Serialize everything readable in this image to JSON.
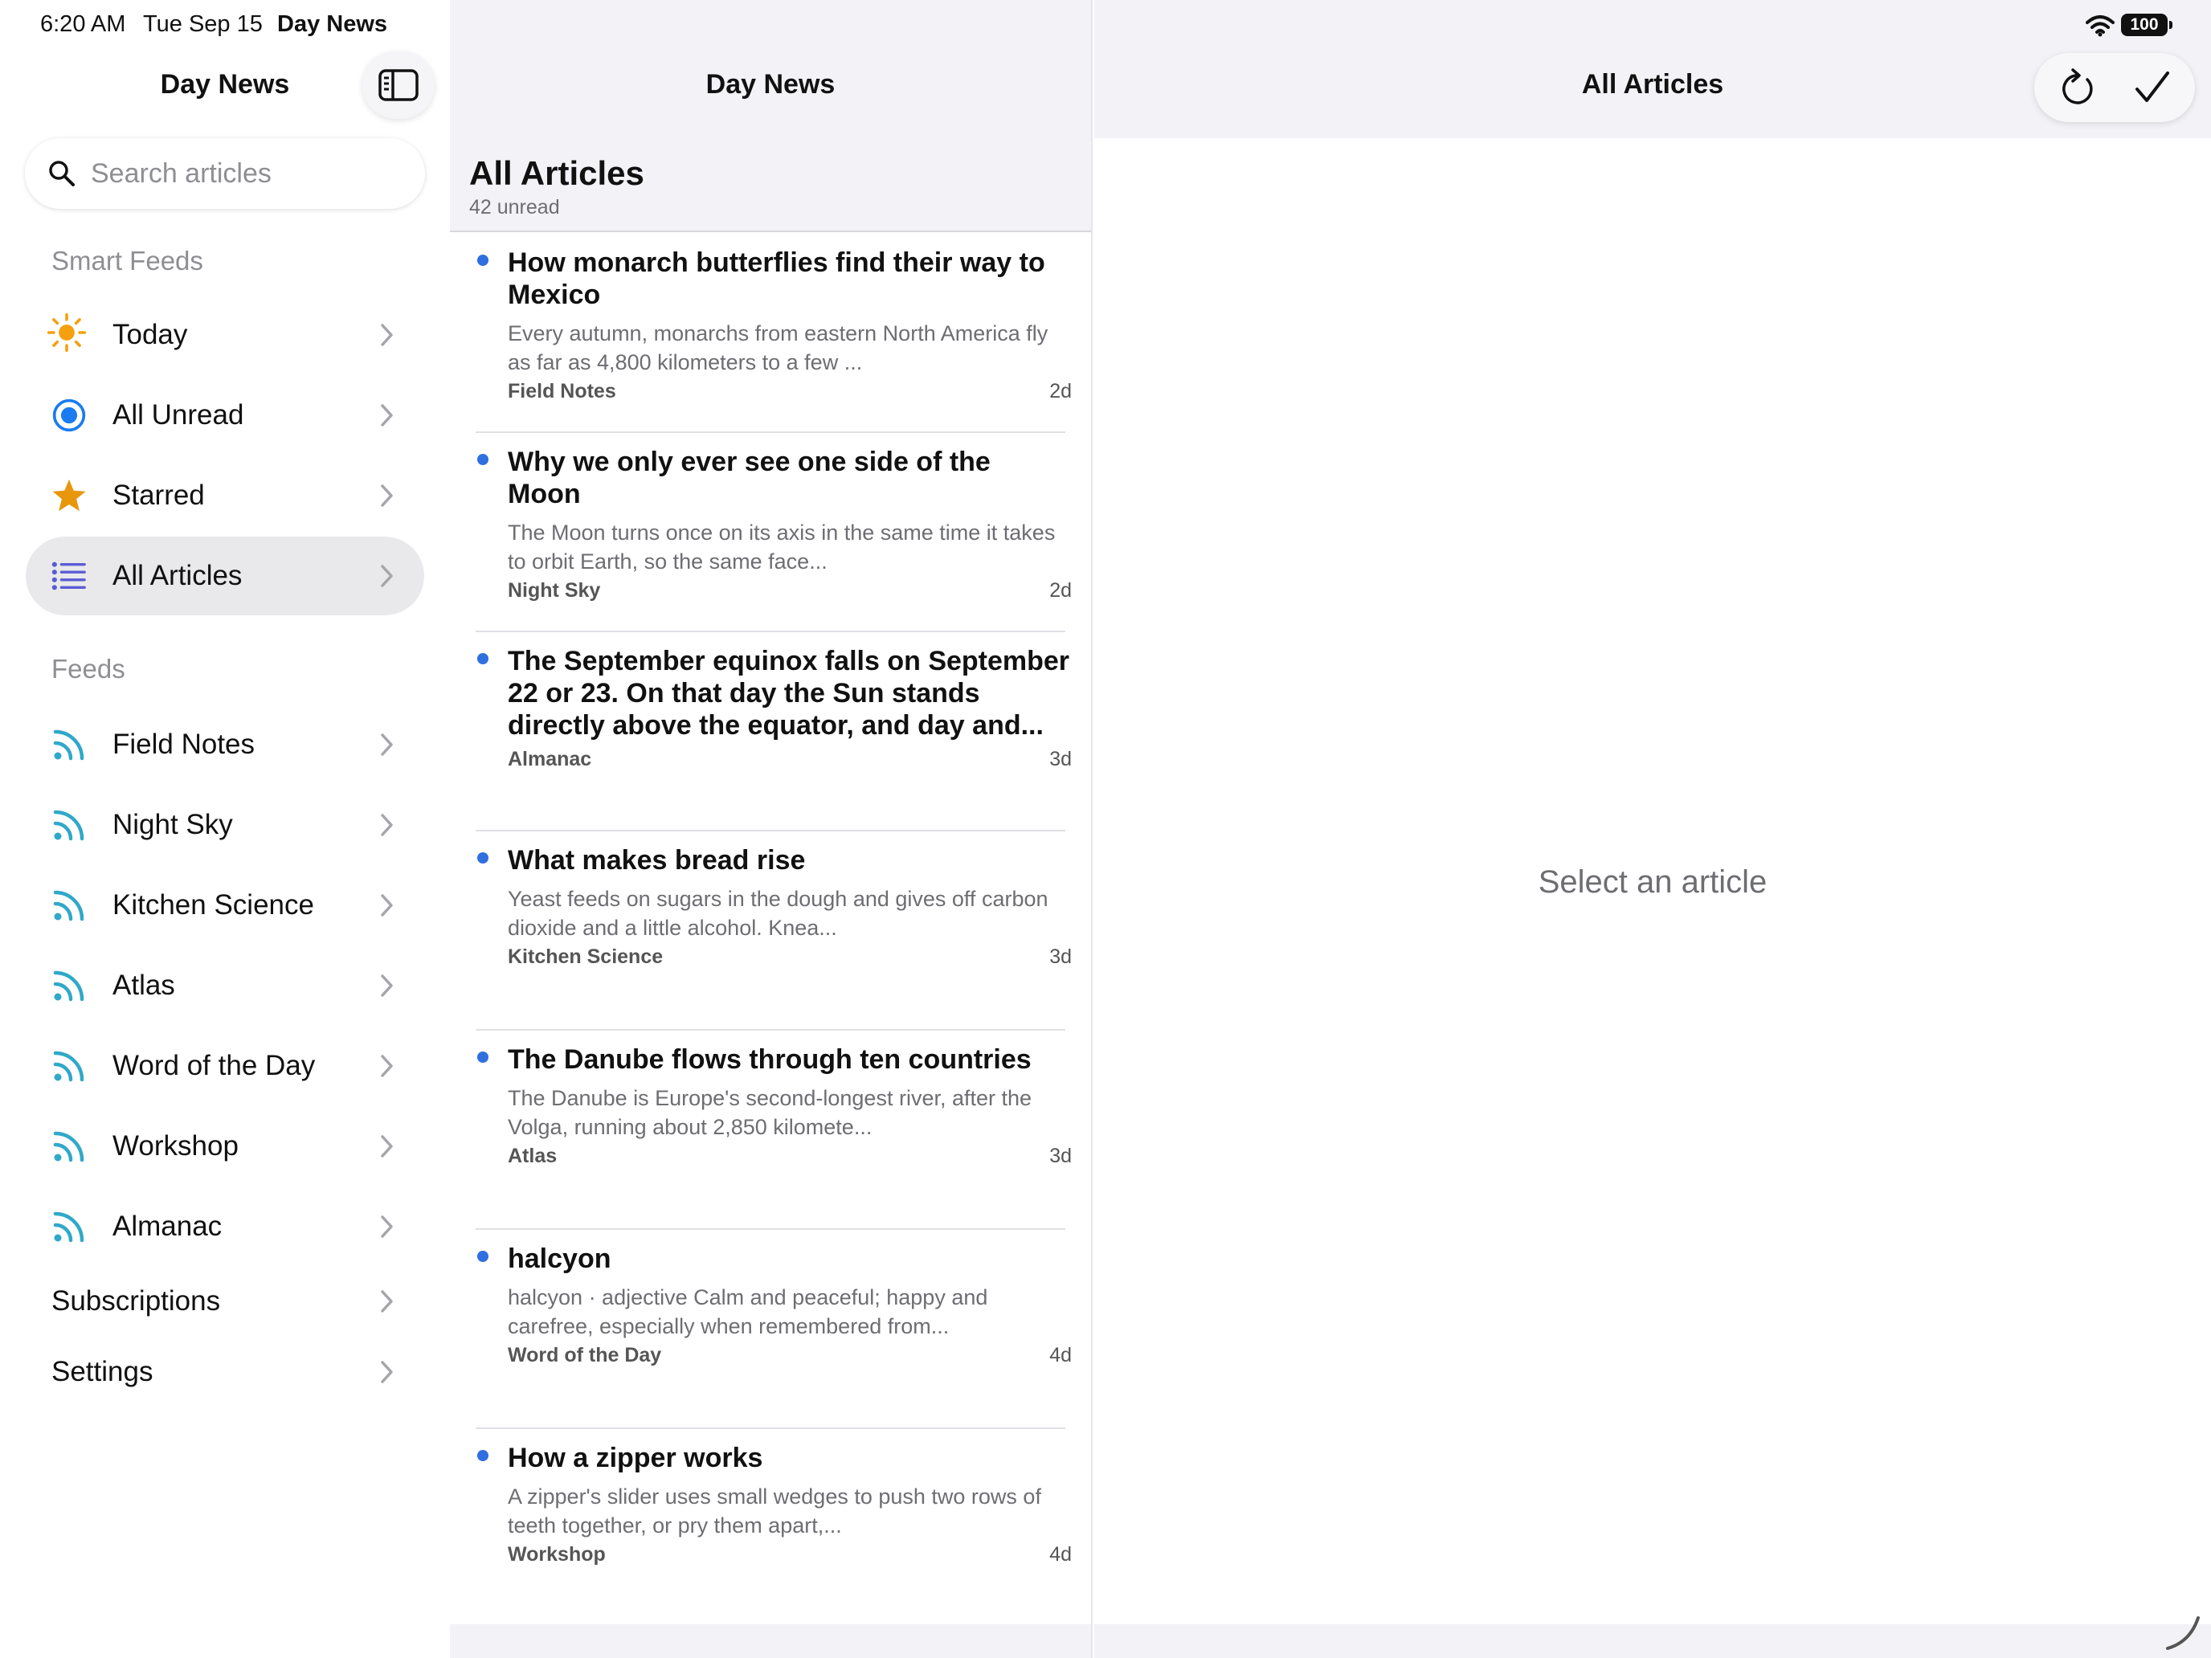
{
  "status": {
    "time": "6:20 AM",
    "date": "Tue Sep 15",
    "app": "Day News",
    "battery": "100"
  },
  "sidebar": {
    "title": "Day News",
    "search_placeholder": "Search articles",
    "smart_feeds_header": "Smart Feeds",
    "smart_feeds": [
      {
        "label": "Today",
        "icon": "sun-icon"
      },
      {
        "label": "All Unread",
        "icon": "unread-circle-icon"
      },
      {
        "label": "Starred",
        "icon": "star-icon"
      },
      {
        "label": "All Articles",
        "icon": "list-icon",
        "selected": true
      }
    ],
    "feeds_header": "Feeds",
    "feeds": [
      {
        "label": "Field Notes",
        "icon": "rss-icon"
      },
      {
        "label": "Night Sky",
        "icon": "rss-icon"
      },
      {
        "label": "Kitchen Science",
        "icon": "rss-icon"
      },
      {
        "label": "Atlas",
        "icon": "rss-icon"
      },
      {
        "label": "Word of the Day",
        "icon": "rss-icon"
      },
      {
        "label": "Workshop",
        "icon": "rss-icon"
      },
      {
        "label": "Almanac",
        "icon": "rss-icon"
      }
    ],
    "subscriptions": "Subscriptions",
    "settings": "Settings"
  },
  "list": {
    "nav_title": "Day News",
    "title": "All Articles",
    "subtitle": "42 unread",
    "articles": [
      {
        "title": "How monarch butterflies find their way to Mexico",
        "excerpt": "Every autumn, monarchs from eastern North America fly as far as 4,800 kilometers to a few ...",
        "source": "Field Notes",
        "age": "2d"
      },
      {
        "title": "Why we only ever see one side of the Moon",
        "excerpt": "The Moon turns once on its axis in the same time it takes to orbit Earth, so the same face...",
        "source": "Night Sky",
        "age": "2d"
      },
      {
        "title": "The September equinox falls on September 22 or 23. On that day the Sun stands directly above the equator, and day and...",
        "excerpt": "",
        "source": "Almanac",
        "age": "3d"
      },
      {
        "title": "What makes bread rise",
        "excerpt": "Yeast feeds on sugars in the dough and gives off carbon dioxide and a little alcohol. Knea...",
        "source": "Kitchen Science",
        "age": "3d"
      },
      {
        "title": "The Danube flows through ten countries",
        "excerpt": "The Danube is Europe's second-longest river, after the Volga, running about 2,850 kilomete...",
        "source": "Atlas",
        "age": "3d"
      },
      {
        "title": "halcyon",
        "excerpt": "halcyon · adjective Calm and peaceful; happy and carefree, especially when remembered from...",
        "source": "Word of the Day",
        "age": "4d"
      },
      {
        "title": "How a zipper works",
        "excerpt": "A zipper's slider uses small wedges to push two rows of teeth together, or pry them apart,...",
        "source": "Workshop",
        "age": "4d"
      }
    ]
  },
  "detail": {
    "title": "All Articles",
    "empty": "Select an article"
  },
  "colors": {
    "accent": "#2f6fe0",
    "sun": "#f5a00f",
    "star": "#e8960c",
    "list": "#5b5bd6",
    "rss": "#30a8c9"
  }
}
